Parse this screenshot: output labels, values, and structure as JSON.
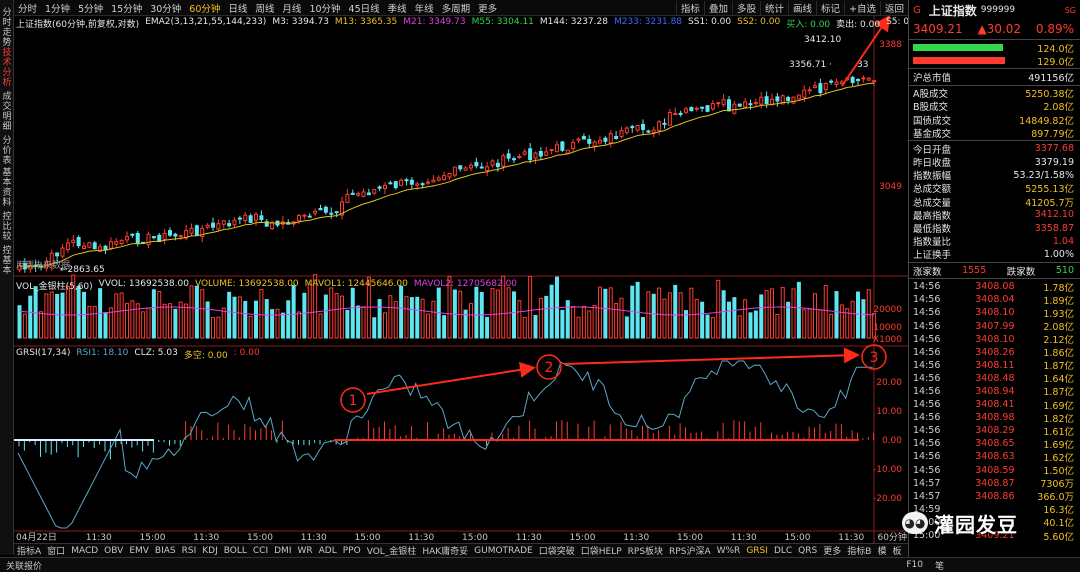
{
  "left_tabs": [
    {
      "label": "分时走势",
      "active": false
    },
    {
      "label": "技术分析",
      "active": true
    },
    {
      "label": "成交明细",
      "active": false
    },
    {
      "label": "分价表",
      "active": false
    },
    {
      "label": "基本资料",
      "active": false
    },
    {
      "label": "控比较",
      "active": false
    },
    {
      "label": "控基本",
      "active": false
    }
  ],
  "periods": [
    "分时",
    "1分钟",
    "5分钟",
    "15分钟",
    "30分钟",
    "60分钟",
    "日线",
    "周线",
    "月线",
    "10分钟",
    "45日线",
    "季线",
    "年线",
    "多周期",
    "更多"
  ],
  "active_period": "60分钟",
  "tools": [
    "指标",
    "叠加",
    "多股",
    "统计",
    "画线",
    "标记",
    "+自选",
    "返回"
  ],
  "main_legend": {
    "title": "上证指数(60分钟,前复权,对数)",
    "ema": "EMA2(3,13,21,55,144,233)",
    "m3": "M3: 3394.73",
    "m13": "M13: 3365.35",
    "m21": "M21: 3349.73",
    "m55": "M55: 3304.11",
    "m144": "M144: 3237.28",
    "m233": "M233: 3231.88",
    "ss1": "SS1: 0.00",
    "ss2": "SS2: 0.00",
    "buy": "买入: 0.00",
    "sell": "卖出: 0.00",
    "s5": "S5: 0.00"
  },
  "price_labels": {
    "high": "3412.10",
    "low_right": "3356.71",
    "low_right_suffix": "33",
    "low": "2863.65",
    "axis_top": "3388",
    "axis_mid": "3049",
    "note": "用到未来数据"
  },
  "vol_legend": {
    "title": "VOL_金银柱(5,60)",
    "vvol": "VVOL: 13692538.00",
    "volume": "VOLUME: 13692538.00",
    "mavol1": "MAVOL1: 12445646.00",
    "mavol2": "MAVOL2: 12705682.00",
    "axis_20000": "20000",
    "axis_10000": "10000",
    "axis_x1000": "X1000"
  },
  "grsi_legend": {
    "title": "GRSI(17,34)",
    "rsi1": "RSI1: 18.10",
    "clz": "CLZ: 5.03",
    "duo": "多空: 0.00",
    "zero": ": 0.00",
    "axis": [
      "20.00",
      "10.00",
      "0.00",
      "-10.00",
      "-20.00"
    ]
  },
  "annotations": [
    "1",
    "2",
    "3"
  ],
  "time_axis": [
    "04月22日",
    "11:30",
    "15:00",
    "11:30",
    "15:00",
    "11:30",
    "15:00",
    "11:30",
    "15:00",
    "11:30",
    "15:00",
    "11:30",
    "15:00",
    "11:30",
    "15:00",
    "11:30",
    "60分钟"
  ],
  "indicators": [
    "指标A",
    "窗口",
    "MACD",
    "OBV",
    "EMV",
    "BIAS",
    "RSI",
    "KDJ",
    "BOLL",
    "CCI",
    "DMI",
    "WR",
    "ADL",
    "PPO",
    "VOL_金银柱",
    "HAK庸奇妥",
    "GUMOTRADE",
    "口袋突破",
    "口袋HELP",
    "RPS板块",
    "RPS沪深A",
    "W%R",
    "GRSI",
    "DLC",
    "QRS",
    "更多",
    "指标B",
    "模",
    "板"
  ],
  "active_indicator": "GRSI",
  "status": {
    "left": "关联报价",
    "right_code": "F10",
    "right_tag": "笔"
  },
  "quote": {
    "flag": "G",
    "name": "上证指数",
    "code": "999999",
    "sg": "SG",
    "price": "3409.21",
    "change": "▲30.02",
    "pct": "0.89%",
    "bar1": "124.0亿",
    "bar2": "129.0亿"
  },
  "stats": [
    {
      "label": "沪总市值",
      "value": "491156亿",
      "color": "white"
    },
    {
      "label": "A股成交",
      "value": "5250.38亿",
      "color": "yellow"
    },
    {
      "label": "B股成交",
      "value": "2.08亿",
      "color": "yellow"
    },
    {
      "label": "国债成交",
      "value": "14849.82亿",
      "color": "yellow"
    },
    {
      "label": "基金成交",
      "value": "897.79亿",
      "color": "yellow"
    },
    {
      "label": "今日开盘",
      "value": "3377.68",
      "color": "red"
    },
    {
      "label": "昨日收盘",
      "value": "3379.19",
      "color": "white"
    },
    {
      "label": "指数振幅",
      "value": "53.23/1.58%",
      "color": "white"
    },
    {
      "label": "总成交额",
      "value": "5255.13亿",
      "color": "yellow"
    },
    {
      "label": "总成交量",
      "value": "41205.7万",
      "color": "yellow"
    },
    {
      "label": "最高指数",
      "value": "3412.10",
      "color": "red"
    },
    {
      "label": "最低指数",
      "value": "3358.87",
      "color": "red"
    },
    {
      "label": "指数量比",
      "value": "1.04",
      "color": "red"
    },
    {
      "label": "上证换手",
      "value": "1.00%",
      "color": "white"
    }
  ],
  "breadth": {
    "up_label": "涨家数",
    "up": "1555",
    "down_label": "跌家数",
    "down": "510"
  },
  "ticks": [
    {
      "t": "14:56",
      "p": "3408.08",
      "v": "1.78亿"
    },
    {
      "t": "14:56",
      "p": "3408.04",
      "v": "1.89亿"
    },
    {
      "t": "14:56",
      "p": "3408.10",
      "v": "1.93亿"
    },
    {
      "t": "14:56",
      "p": "3407.99",
      "v": "2.08亿"
    },
    {
      "t": "14:56",
      "p": "3408.10",
      "v": "2.12亿"
    },
    {
      "t": "14:56",
      "p": "3408.26",
      "v": "1.86亿"
    },
    {
      "t": "14:56",
      "p": "3408.11",
      "v": "1.87亿"
    },
    {
      "t": "14:56",
      "p": "3408.48",
      "v": "1.64亿"
    },
    {
      "t": "14:56",
      "p": "3408.94",
      "v": "1.87亿"
    },
    {
      "t": "14:56",
      "p": "3408.41",
      "v": "1.69亿"
    },
    {
      "t": "14:56",
      "p": "3408.98",
      "v": "1.82亿"
    },
    {
      "t": "14:56",
      "p": "3408.29",
      "v": "1.61亿"
    },
    {
      "t": "14:56",
      "p": "3408.65",
      "v": "1.69亿"
    },
    {
      "t": "14:56",
      "p": "3408.63",
      "v": "1.62亿"
    },
    {
      "t": "14:56",
      "p": "3408.59",
      "v": "1.50亿"
    },
    {
      "t": "14:57",
      "p": "3408.87",
      "v": "7306万"
    },
    {
      "t": "14:57",
      "p": "3408.86",
      "v": "366.0万"
    },
    {
      "t": "14:59",
      "p": "",
      "v": "16.3亿"
    },
    {
      "t": "15:00",
      "p": "",
      "v": "40.1亿"
    },
    {
      "t": "15:00",
      "p": "3409.21",
      "v": "5.60亿"
    }
  ],
  "watermark": "灌园发豆",
  "colors": {
    "up": "#ff3b30",
    "down": "#5ee6f0",
    "ema": "#e8c020",
    "grsi": "#5aa8c8",
    "arrow": "#ff2a1a"
  }
}
